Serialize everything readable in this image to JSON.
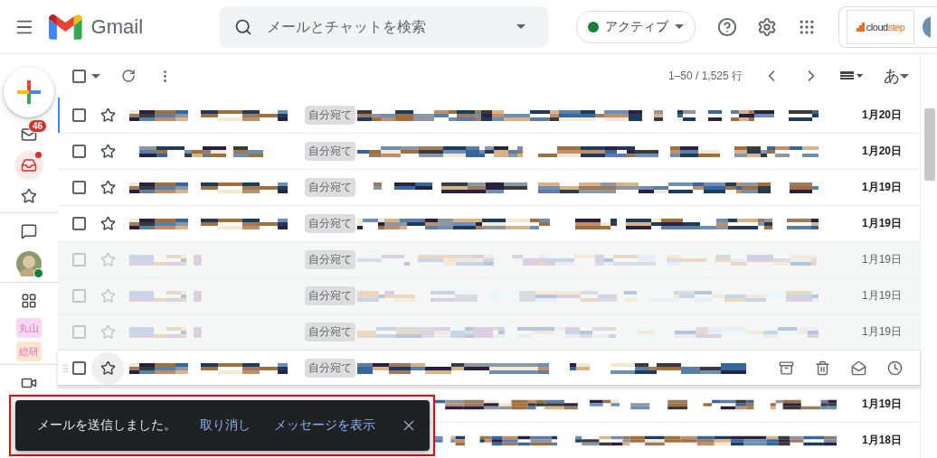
{
  "header": {
    "app_name": "Gmail",
    "search": {
      "placeholder": "メールとチャットを検索"
    },
    "status": {
      "label": "アクティブ",
      "color": "#188038"
    },
    "account": {
      "logo_main": "cloud",
      "logo_accent": "step"
    }
  },
  "rail": [
    {
      "kind": "compose"
    },
    {
      "kind": "mail",
      "badge": "46",
      "selected": false
    },
    {
      "kind": "inbox",
      "selected": true,
      "dot": true
    },
    {
      "kind": "star",
      "selected": false
    },
    {
      "kind": "divider"
    },
    {
      "kind": "chat",
      "selected": false
    },
    {
      "kind": "avatar",
      "online": true
    },
    {
      "kind": "divider"
    },
    {
      "kind": "spaces",
      "selected": false
    },
    {
      "kind": "label",
      "text": "丸山",
      "color": "#f8d7f0"
    },
    {
      "kind": "label",
      "text": "総研",
      "color": "#fde6d0"
    },
    {
      "kind": "divider"
    },
    {
      "kind": "video",
      "selected": false
    }
  ],
  "toolbar": {
    "select_all_checked": false,
    "range": "1–50 / 1,525 行",
    "input_tool": "あ"
  },
  "rows": [
    {
      "tag": "自分宛て",
      "date": "1月20日",
      "unread": true,
      "focused": true,
      "hovered": false
    },
    {
      "tag": "自分宛て",
      "date": "1月20日",
      "unread": true,
      "focused": false,
      "hovered": false
    },
    {
      "tag": "自分宛て",
      "date": "1月19日",
      "unread": true,
      "focused": false,
      "hovered": false
    },
    {
      "tag": "自分宛て",
      "date": "1月19日",
      "unread": true,
      "focused": false,
      "hovered": false
    },
    {
      "tag": "自分宛て",
      "date": "1月19日",
      "unread": false,
      "focused": false,
      "hovered": false
    },
    {
      "tag": "自分宛て",
      "date": "1月19日",
      "unread": false,
      "focused": false,
      "hovered": false
    },
    {
      "tag": "自分宛て",
      "date": "1月19日",
      "unread": false,
      "focused": false,
      "hovered": false
    },
    {
      "tag": "自分宛て",
      "unread": true,
      "focused": false,
      "hovered": true
    },
    {
      "date": "1月19日",
      "unread": true,
      "focused": false,
      "hovered": false,
      "covered": true
    },
    {
      "date": "1月18日",
      "unread": true,
      "focused": false,
      "hovered": false,
      "covered": true
    }
  ],
  "toast": {
    "message": "メールを送信しました。",
    "actions": [
      "取り消し",
      "メッセージを表示"
    ],
    "highlighted": true
  }
}
